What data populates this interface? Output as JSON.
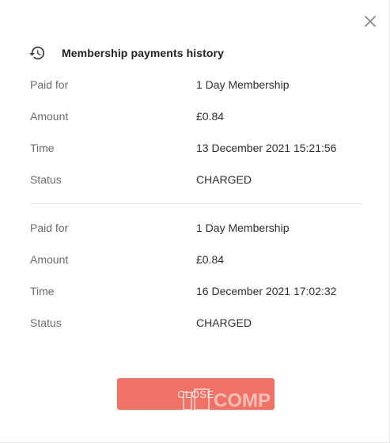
{
  "dialog": {
    "title": "Membership payments history",
    "close_label": "CLOSE"
  },
  "payments": [
    {
      "paid_for_label": "Paid for",
      "paid_for": "1 Day Membership",
      "amount_label": "Amount",
      "amount": "£0.84",
      "time_label": "Time",
      "time": "13 December 2021 15:21:56",
      "status_label": "Status",
      "status": "CHARGED"
    },
    {
      "paid_for_label": "Paid for",
      "paid_for": "1 Day Membership",
      "amount_label": "Amount",
      "amount": "£0.84",
      "time_label": "Time",
      "time": "16 December 2021 17:02:32",
      "status_label": "Status",
      "status": "CHARGED"
    }
  ],
  "watermark": {
    "text": "COMP"
  },
  "colors": {
    "button": "#f07165",
    "text": "#2e2e2e",
    "label": "#6b6b6b",
    "divider": "#e3e3e3"
  },
  "icons": {
    "header": "history-icon",
    "close": "close-icon"
  }
}
